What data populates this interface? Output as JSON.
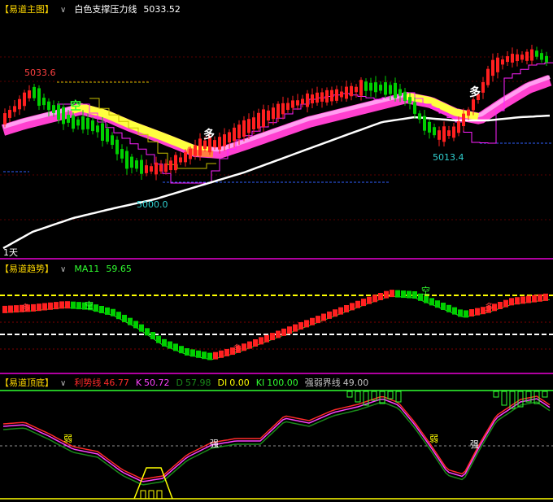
{
  "panes": {
    "main": {
      "title": "【易道主图】",
      "indicator_label": "白色支撑压力线",
      "indicator_value": "5033.52",
      "period_label": "1天",
      "price_labels": {
        "high_left": "5033.6",
        "low_left": "5000.0",
        "low_right": "5013.4"
      },
      "signals": [
        "空",
        "多",
        "多"
      ]
    },
    "trend": {
      "title": "【易道趋势】",
      "ma_label": "MA11",
      "ma_value": "59.65",
      "signals": [
        "多",
        "空",
        "多",
        "空",
        "多"
      ]
    },
    "bottom": {
      "title": "【易道顶底】",
      "items": [
        {
          "label": "利势线",
          "value": "46.77",
          "color": "#ff2a2a"
        },
        {
          "label": "K",
          "value": "50.72",
          "color": "#ff40ff"
        },
        {
          "label": "D",
          "value": "57.98",
          "color": "#1a8a1a"
        },
        {
          "label": "DI",
          "value": "0.00",
          "color": "#ffff00"
        },
        {
          "label": "KI",
          "value": "100.00",
          "color": "#30ff30"
        },
        {
          "label": "强弱界线",
          "value": "49.00",
          "color": "#c0c0c0"
        }
      ],
      "signals": [
        "弱",
        "强",
        "弱",
        "强"
      ]
    }
  },
  "colors": {
    "up_candle": "#ff2020",
    "down_candle": "#00d000",
    "support_line": "#ffffff",
    "ribbon_pink": "#ff40d0",
    "ribbon_yellow": "#ffff40",
    "trend_up": "#ff2020",
    "trend_down": "#00d000",
    "ref_yellow": "#ffff00",
    "ref_white": "#ffffff"
  }
}
